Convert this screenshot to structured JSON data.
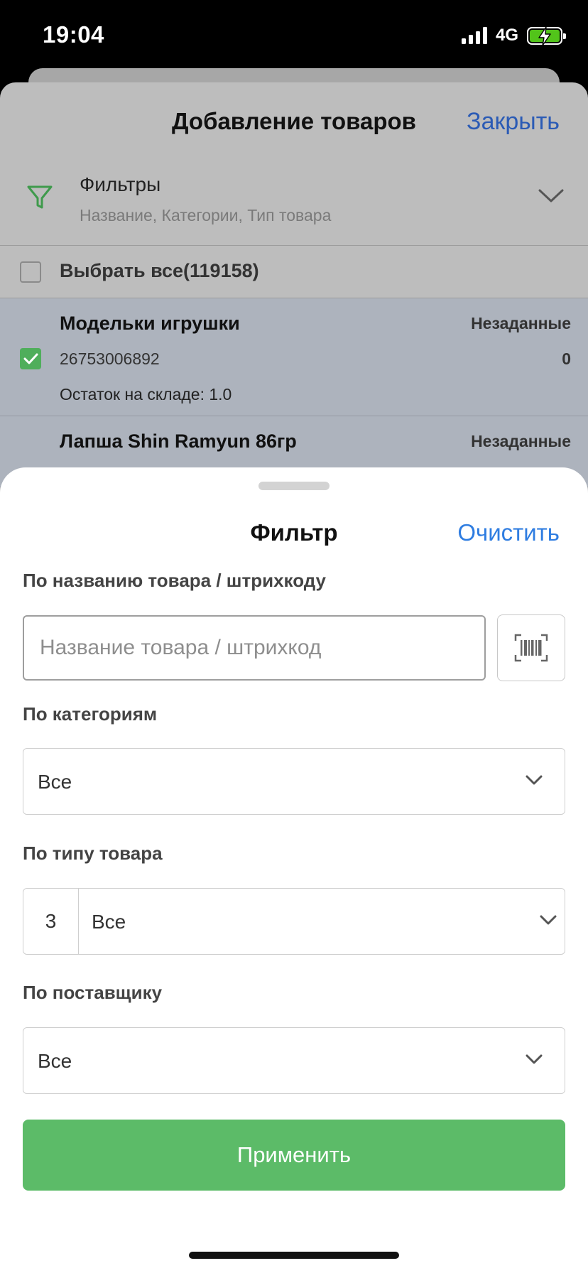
{
  "status_bar": {
    "time": "19:04",
    "network": "4G",
    "icons": [
      "signal-icon",
      "battery-charging-icon"
    ]
  },
  "background_screen": {
    "title": "Добавление товаров",
    "close_label": "Закрыть",
    "filters": {
      "title": "Фильтры",
      "subtitle": "Название, Категории, Тип товара",
      "icon": "filter-icon"
    },
    "select_all_label": "Выбрать все(119158)",
    "products": [
      {
        "name": "Модельки игрушки",
        "status": "Незаданные",
        "code": "26753006892",
        "qty": "0",
        "stock": "Остаток на складе: 1.0",
        "checked": true
      },
      {
        "name": "Лапша Shin Ramyun 86гр",
        "status": "Незаданные",
        "checked": true
      }
    ]
  },
  "filter_sheet": {
    "title": "Фильтр",
    "clear_label": "Очистить",
    "by_name": {
      "label": "По названию товара / штрихкоду",
      "placeholder": "Название товара / штрихкод",
      "value": ""
    },
    "by_category": {
      "label": "По категориям",
      "value": "Все"
    },
    "by_type": {
      "label": "По типу товара",
      "count": "3",
      "value": "Все"
    },
    "by_supplier": {
      "label": "По поставщику",
      "value": "Все"
    },
    "apply_label": "Применить"
  },
  "colors": {
    "accent_green": "#5cbb68",
    "link_blue": "#2f7de1",
    "checkbox_green": "#4fae5b"
  }
}
